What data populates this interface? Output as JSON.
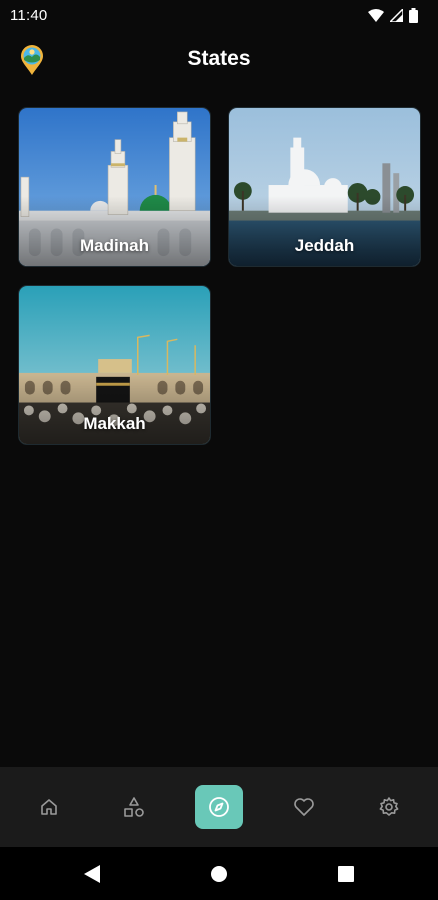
{
  "status_bar": {
    "time": "11:40",
    "icons": [
      "wifi-icon",
      "cell-signal-icon",
      "battery-icon"
    ]
  },
  "app_bar": {
    "title": "States",
    "logo_icon": "location-pin-logo-icon"
  },
  "states": [
    {
      "name": "Madinah"
    },
    {
      "name": "Jeddah"
    },
    {
      "name": "Makkah"
    }
  ],
  "bottom_nav": {
    "items": [
      {
        "icon": "home-icon",
        "active": false
      },
      {
        "icon": "categories-icon",
        "active": false
      },
      {
        "icon": "compass-icon",
        "active": true
      },
      {
        "icon": "heart-icon",
        "active": false
      },
      {
        "icon": "settings-gear-icon",
        "active": false
      }
    ],
    "accent_color": "#69c8b8"
  },
  "system_nav": {
    "buttons": [
      "back-icon",
      "home-circle-icon",
      "recents-icon"
    ]
  },
  "colors": {
    "background": "#0a0a0a",
    "nav_background": "#1b1b1b"
  }
}
